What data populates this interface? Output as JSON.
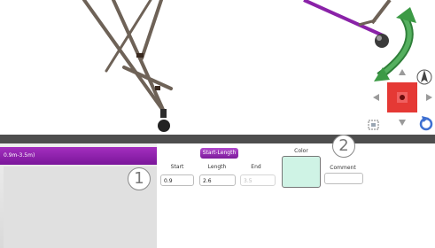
{
  "range_item_label": "0.9m-3.5m)",
  "properties": {
    "section_button": "Start-Length",
    "start_label": "Start",
    "start_value": "0.9",
    "length_label": "Length",
    "length_value": "2.6",
    "end_label": "End",
    "end_value": "3.5",
    "color_label": "Color",
    "color_value": "#cff3e5",
    "comment_label": "Comment",
    "comment_value": ""
  },
  "callouts": [
    "1",
    "2"
  ],
  "colors": {
    "accent_purple": "#8a22a8",
    "gizmo_red": "#e53935",
    "arrow_green": "#3c9a45"
  }
}
